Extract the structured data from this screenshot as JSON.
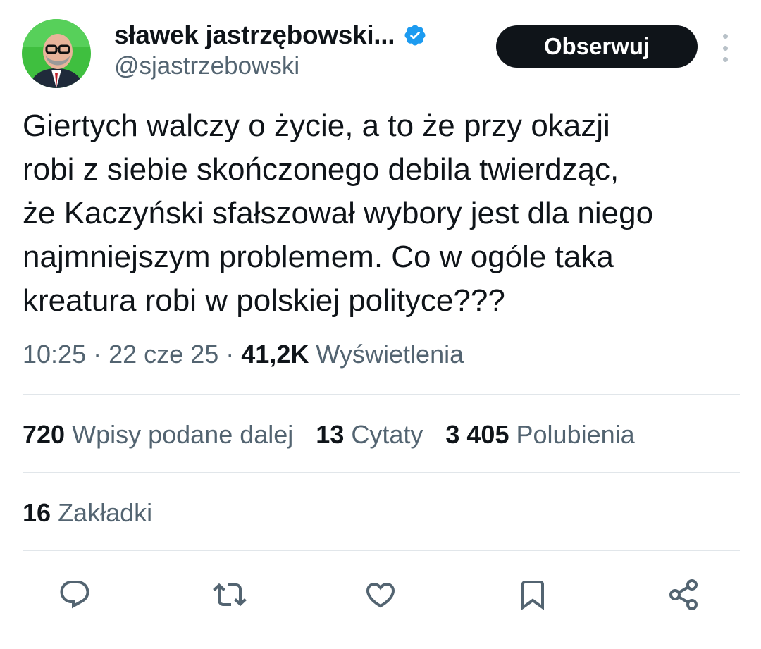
{
  "author": {
    "display_name": "sławek jastrzębowski...",
    "handle": "@sjastrzebowski",
    "verified": true
  },
  "follow_button": {
    "label": "Obserwuj"
  },
  "tweet": {
    "text": "Giertych walczy o życie, a to że przy okazji\nrobi z siebie skończonego debila twierdząc,\nże Kaczyński sfałszował wybory jest dla niego\nnajmniejszym problemem. Co w ogóle taka\nkreatura robi w polskiej polityce???"
  },
  "meta": {
    "time": "10:25",
    "separator": "·",
    "date": "22 cze 25",
    "views_count": "41,2K",
    "views_label": "Wyświetlenia"
  },
  "stats": {
    "reposts_count": "720",
    "reposts_label": "Wpisy podane dalej",
    "quotes_count": "13",
    "quotes_label": "Cytaty",
    "likes_count": "3 405",
    "likes_label": "Polubienia",
    "bookmarks_count": "16",
    "bookmarks_label": "Zakładki"
  },
  "icons": {
    "verified": "verified-badge-icon",
    "more": "more-vertical-icon",
    "reply": "reply-icon",
    "repost": "repost-icon",
    "like": "heart-icon",
    "bookmark": "bookmark-icon",
    "share": "share-icon"
  },
  "colors": {
    "text_primary": "#0f1419",
    "text_secondary": "#536471",
    "verified_blue": "#1d9bf0",
    "button_bg": "#0f1419",
    "divider": "#e1e6ea"
  }
}
